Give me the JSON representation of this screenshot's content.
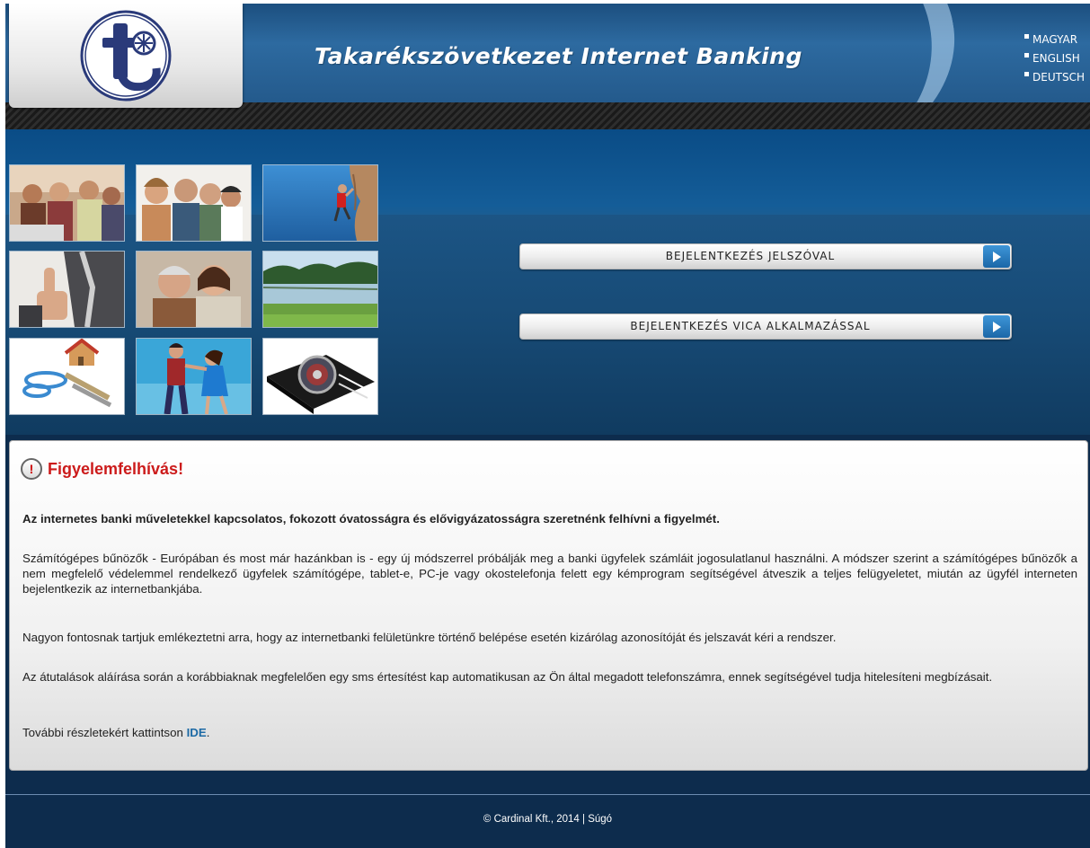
{
  "header": {
    "title": "Takarékszövetkezet Internet Banking",
    "logo_icon": "takarekszovetkezet-logo-icon",
    "languages": [
      "MAGYAR",
      "ENGLISH",
      "DEUTSCH"
    ]
  },
  "login": {
    "password_button": "BEJELENTKEZÉS JELSZÓVAL",
    "vica_button": "BEJELENTKEZÉS VICA ALKALMAZÁSSAL"
  },
  "notice": {
    "title": "Figyelemfelhívás!",
    "lead": "Az internetes banki műveletekkel kapcsolatos, fokozott óvatosságra és elővigyázatosságra szeretnénk felhívni a figyelmét.",
    "paragraph1": "Számítógépes bűnözők - Európában és most már hazánkban is - egy új módszerrel próbálják meg a banki ügyfelek számláit jogosulatlanul használni. A módszer szerint a számítógépes bűnözők a nem megfelelő védelemmel rendelkező ügyfelek számítógépe, tablet-e, PC-je vagy okostelefonja felett egy kémprogram segítségével átveszik a teljes felügyeletet, miután az ügyfél interneten bejelentkezik az internetbankjába.",
    "paragraph2": "Nagyon fontosnak tartjuk emlékeztetni arra, hogy az internetbanki felületünkre történő belépése esetén kizárólag azonosítóját és jelszavát kéri a rendszer.",
    "paragraph3": "Az átutalások aláírása során a korábbiaknak megfelelően egy sms értesítést kap automatikusan az Ön által megadott telefonszámra, ennek segítségével tudja hitelesíteni megbízásait.",
    "more_prefix": "További részletekért kattintson ",
    "more_link": "IDE",
    "more_suffix": "."
  },
  "footer": {
    "copyright": "© Cardinal Kft., 2014 | ",
    "help_link": "Súgó"
  },
  "colors": {
    "accent": "#1d6aa5",
    "alert": "#cc1b1b",
    "header": "#245a8c"
  }
}
